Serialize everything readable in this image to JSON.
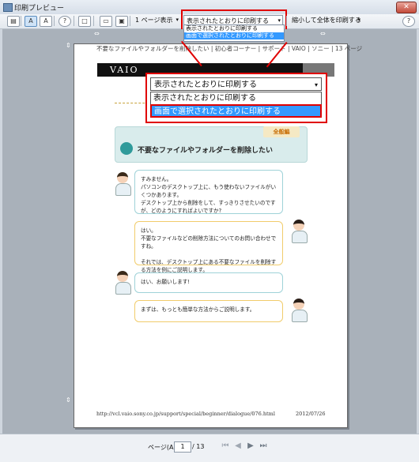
{
  "window": {
    "title": "印刷プレビュー",
    "close_label": "✕"
  },
  "toolbar": {
    "zoom_label": "1 ページ表示",
    "print_mode_value": "表示されたとおりに印刷する",
    "print_mode_options": [
      "表示されたとおりに印刷する",
      "画面で選択されたとおりに印刷する"
    ],
    "shrink_value": "縮小して全体を印刷する",
    "font_a_small": "A",
    "font_a_large": "A"
  },
  "page": {
    "header": "不要なファイルやフォルダーを削除したい | 初心者コーナー | サポート | VAIO | ソニー | 13 ページ",
    "logo": "VAIO",
    "badge": "全般編",
    "feature_title": "不要なファイルやフォルダーを削除したい",
    "dialogue": [
      "すみません。\nパソコンのデスクトップ上に、もう使わないファイルがいくつかあります。\nデスクトップ上から削除をして、すっきりさせたいのですが、どのようにすればよいですか?",
      "はい。\n不要なファイルなどの削除方法についてのお問い合わせですね。\n\nそれでは、デスクトップ上にある不要なファイルを削除する方法を例にご説明します。",
      "はい、お願いします!",
      "まずは、もっとも簡単な方法からご説明します。"
    ],
    "url": "http://vcl.vaio.sony.co.jp/support/special/beginner/dialogue/076.html",
    "date": "2012/07/26"
  },
  "callout": {
    "value": "表示されたとおりに印刷する",
    "options": [
      "表示されたとおりに印刷する",
      "画面で選択されたとおりに印刷する"
    ]
  },
  "status": {
    "page_label": "ページ(A)",
    "page_value": "1",
    "page_total": "/ 13"
  }
}
